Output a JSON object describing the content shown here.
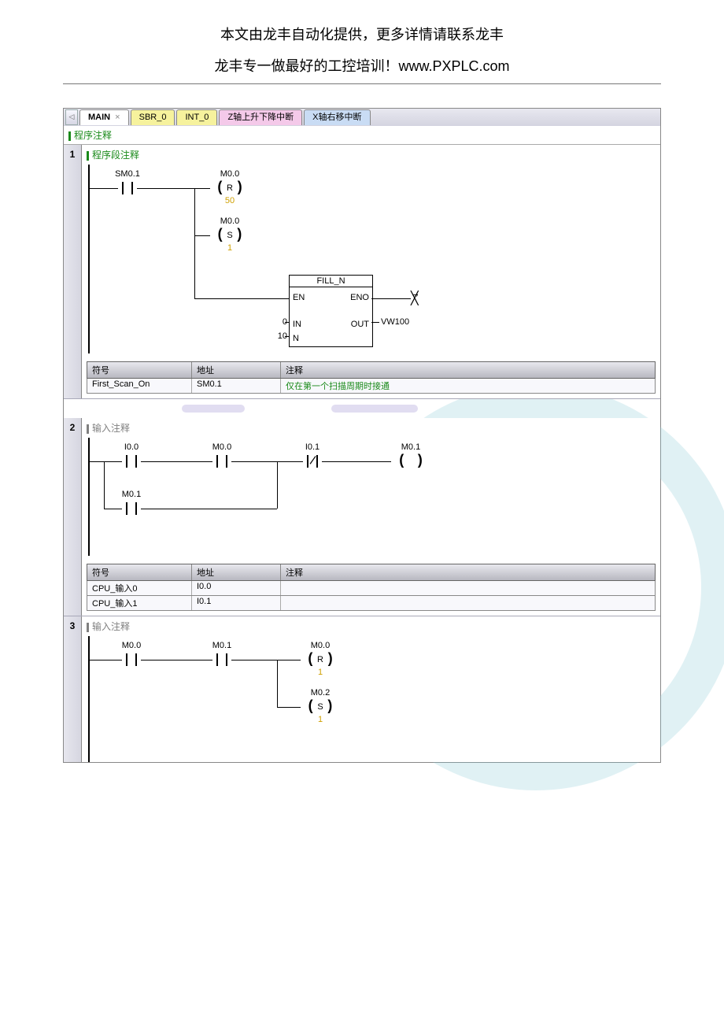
{
  "header": {
    "line1": "本文由龙丰自动化提供，更多详情请联系龙丰",
    "line2": "龙丰专一做最好的工控培训！www.PXPLC.com"
  },
  "tabs": {
    "main": "MAIN",
    "close": "×",
    "sbr": "SBR_0",
    "int": "INT_0",
    "pink": "Z轴上升下降中断",
    "blue": "X轴右移中断"
  },
  "program_comment": "程序注释",
  "networks": [
    {
      "num": "1",
      "title": "程序段注释",
      "ladder": {
        "contact1": "SM0.1",
        "coil_r_lbl": "M0.0",
        "coil_r_inner": "R",
        "coil_r_val": "50",
        "coil_s_lbl": "M0.0",
        "coil_s_inner": "S",
        "coil_s_val": "1",
        "box_title": "FILL_N",
        "box_en": "EN",
        "box_eno": "ENO",
        "box_in": "IN",
        "box_out": "OUT",
        "box_n": "N",
        "box_in_val": "0",
        "box_n_val": "10",
        "box_out_val": "VW100"
      },
      "table": {
        "h_sym": "符号",
        "h_addr": "地址",
        "h_comment": "注释",
        "rows": [
          {
            "sym": "First_Scan_On",
            "addr": "SM0.1",
            "comment": "仅在第一个扫描周期时接通"
          }
        ]
      }
    },
    {
      "num": "2",
      "title": "输入注释",
      "ladder": {
        "c1": "I0.0",
        "c2": "M0.0",
        "c3": "I0.1",
        "coil": "M0.1",
        "c_par": "M0.1"
      },
      "table": {
        "h_sym": "符号",
        "h_addr": "地址",
        "h_comment": "注释",
        "rows": [
          {
            "sym": "CPU_输入0",
            "addr": "I0.0",
            "comment": ""
          },
          {
            "sym": "CPU_输入1",
            "addr": "I0.1",
            "comment": ""
          }
        ]
      }
    },
    {
      "num": "3",
      "title": "输入注释",
      "ladder": {
        "c1": "M0.0",
        "c2": "M0.1",
        "coil_r_lbl": "M0.0",
        "coil_r_inner": "R",
        "coil_r_val": "1",
        "coil_s_lbl": "M0.2",
        "coil_s_inner": "S",
        "coil_s_val": "1"
      }
    }
  ]
}
